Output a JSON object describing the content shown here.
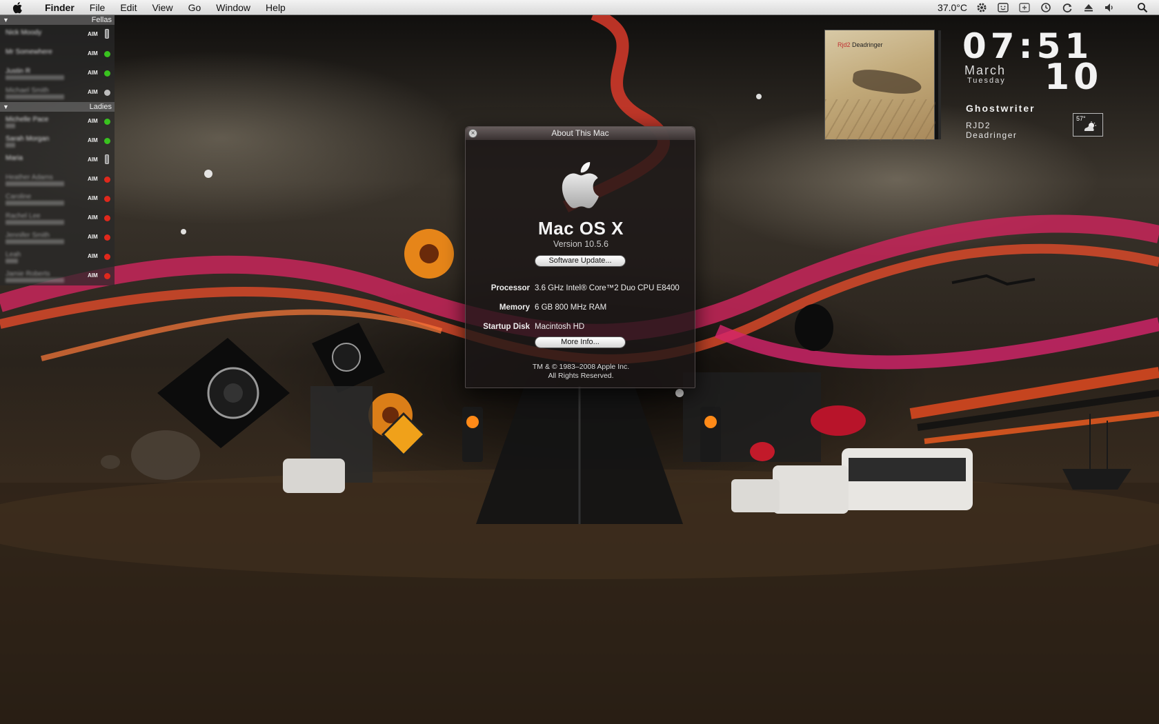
{
  "menubar": {
    "app_name": "Finder",
    "menus": [
      "File",
      "Edit",
      "View",
      "Go",
      "Window",
      "Help"
    ],
    "temperature": "37.0°C",
    "status_icons": [
      "gear-icon",
      "smiley-icon",
      "plus-box-icon",
      "time-machine-icon",
      "sync-icon",
      "eject-icon",
      "volume-icon",
      "spotlight-icon"
    ]
  },
  "buddy_list": {
    "groups": [
      {
        "name": "Fellas",
        "buddies": [
          {
            "name": "Nick Moody",
            "service": "AIM",
            "status": "mobile"
          },
          {
            "name": "Mr Somewhere",
            "service": "AIM",
            "status": "available"
          },
          {
            "name": "Justin R",
            "service": "AIM",
            "status": "available"
          },
          {
            "name": "Michael Smith",
            "service": "AIM",
            "status": "idle"
          }
        ]
      },
      {
        "name": "Ladies",
        "buddies": [
          {
            "name": "Michelle Pace",
            "service": "AIM",
            "status": "available"
          },
          {
            "name": "Sarah Morgan",
            "service": "AIM",
            "status": "available"
          },
          {
            "name": "Maria",
            "service": "AIM",
            "status": "mobile"
          },
          {
            "name": "Heather Adams",
            "service": "AIM",
            "status": "away"
          },
          {
            "name": "Caroline",
            "service": "AIM",
            "status": "away"
          },
          {
            "name": "Rachel Lee",
            "service": "AIM",
            "status": "away"
          },
          {
            "name": "Jennifer Smith",
            "service": "AIM",
            "status": "away"
          },
          {
            "name": "Leah",
            "service": "AIM",
            "status": "away"
          },
          {
            "name": "Jamie Roberts",
            "service": "AIM",
            "status": "away"
          }
        ]
      }
    ],
    "status_colors": {
      "available": "#39c21f",
      "away": "#e0281c",
      "idle": "#bdbdbd"
    }
  },
  "about_window": {
    "title": "About This Mac",
    "os_name": "Mac OS X",
    "version": "Version 10.5.6",
    "software_update_label": "Software Update...",
    "processor_label": "Processor",
    "processor_value": "3.6 GHz Intel® Core™2 Duo CPU E8400",
    "memory_label": "Memory",
    "memory_value": "6 GB 800 MHz RAM",
    "startup_disk_label": "Startup Disk",
    "startup_disk_value": "Macintosh HD",
    "more_info_label": "More Info...",
    "copyright_line1": "TM & © 1983–2008 Apple Inc.",
    "copyright_line2": "All Rights Reserved."
  },
  "now_playing": {
    "album_art_artist": "Rjd2",
    "album_art_title": "Deadringer",
    "song": "Ghostwriter",
    "artist": "RJD2",
    "album": "Deadringer"
  },
  "clock": {
    "time": "07:51",
    "month": "March",
    "weekday": "Tuesday",
    "day": "10"
  },
  "weather": {
    "temperature": "57°",
    "icon": "partly-cloudy-icon"
  }
}
